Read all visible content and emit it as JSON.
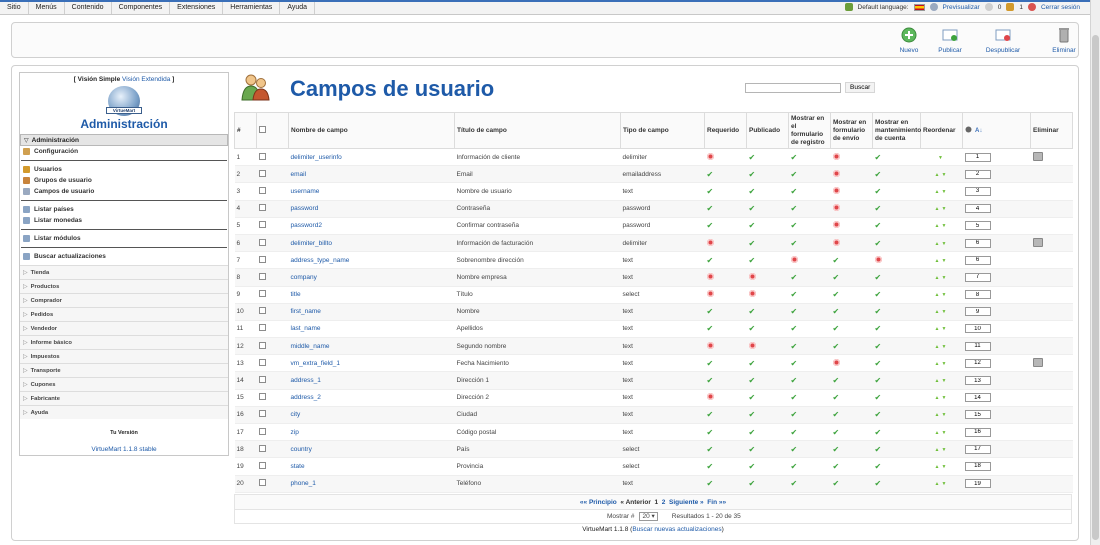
{
  "menubar": {
    "items": [
      "Sitio",
      "Menús",
      "Contenido",
      "Componentes",
      "Extensiones",
      "Herramientas",
      "Ayuda"
    ],
    "default_language_label": "Default language:",
    "preview_label": "Previsualizar",
    "messages_count": "0",
    "users_count": "1",
    "logout_label": "Cerrar sesión"
  },
  "toolbar": {
    "new_label": "Nuevo",
    "publish_label": "Publicar",
    "unpublish_label": "Despublicar",
    "delete_label": "Eliminar"
  },
  "sidebar": {
    "view_simple": "[ Visión Simple",
    "view_extended": "Visión Extendida",
    "view_close": "]",
    "logo_text": "VirtueMart",
    "title": "Administración",
    "section_header": "Administración",
    "config_label": "Configuración",
    "user_items": [
      "Usuarios",
      "Grupos de usuario",
      "Campos de usuario"
    ],
    "list_items": [
      "Listar países",
      "Listar monedas"
    ],
    "modules_label": "Listar módulos",
    "updates_label": "Buscar actualizaciones",
    "collapsed_sections": [
      "Tienda",
      "Productos",
      "Comprador",
      "Pedidos",
      "Vendedor",
      "Informe básico",
      "Impuestos",
      "Transporte",
      "Cupones",
      "Fabricante",
      "Ayuda"
    ],
    "version_heading": "Tu Versión",
    "version_link": "VirtueMart 1.1.8 stable"
  },
  "page": {
    "title": "Campos de usuario",
    "search_button": "Buscar"
  },
  "table": {
    "headers": {
      "num": "#",
      "field_name": "Nombre de campo",
      "field_title": "Título de campo",
      "field_type": "Tipo de campo",
      "required": "Requerido",
      "published": "Publicado",
      "show_register": "Mostrar en el formulario de registro",
      "show_shipping": "Mostrar en formulario de envío",
      "show_account": "Mostrar en mantenimiento de cuenta",
      "reorder": "Reordenar",
      "delete": "Eliminar"
    },
    "rows": [
      {
        "n": "1",
        "name": "delimiter_userinfo",
        "title": "Información de cliente",
        "type": "delimiter",
        "req": false,
        "pub": true,
        "reg": true,
        "ship": false,
        "acct": true,
        "up": false,
        "down": true,
        "order": "1",
        "del": true
      },
      {
        "n": "2",
        "name": "email",
        "title": "Email",
        "type": "emailaddress",
        "req": true,
        "pub": true,
        "reg": true,
        "ship": false,
        "acct": true,
        "up": true,
        "down": true,
        "order": "2",
        "del": false
      },
      {
        "n": "3",
        "name": "username",
        "title": "Nombre de usuario",
        "type": "text",
        "req": true,
        "pub": true,
        "reg": true,
        "ship": false,
        "acct": true,
        "up": true,
        "down": true,
        "order": "3",
        "del": false
      },
      {
        "n": "4",
        "name": "password",
        "title": "Contraseña",
        "type": "password",
        "req": true,
        "pub": true,
        "reg": true,
        "ship": false,
        "acct": true,
        "up": true,
        "down": true,
        "order": "4",
        "del": false
      },
      {
        "n": "5",
        "name": "password2",
        "title": "Confirmar contraseña",
        "type": "password",
        "req": true,
        "pub": true,
        "reg": true,
        "ship": false,
        "acct": true,
        "up": true,
        "down": true,
        "order": "5",
        "del": false
      },
      {
        "n": "6",
        "name": "delimiter_billto",
        "title": "Información de facturación",
        "type": "delimiter",
        "req": false,
        "pub": true,
        "reg": true,
        "ship": false,
        "acct": true,
        "up": true,
        "down": true,
        "order": "6",
        "del": true
      },
      {
        "n": "7",
        "name": "address_type_name",
        "title": "Sobrenombre dirección",
        "type": "text",
        "req": true,
        "pub": true,
        "reg": false,
        "ship": true,
        "acct": false,
        "up": true,
        "down": true,
        "order": "6",
        "del": false
      },
      {
        "n": "8",
        "name": "company",
        "title": "Nombre empresa",
        "type": "text",
        "req": false,
        "pub": false,
        "reg": true,
        "ship": true,
        "acct": true,
        "up": true,
        "down": true,
        "order": "7",
        "del": false
      },
      {
        "n": "9",
        "name": "title",
        "title": "Título",
        "type": "select",
        "req": false,
        "pub": false,
        "reg": true,
        "ship": true,
        "acct": true,
        "up": true,
        "down": true,
        "order": "8",
        "del": false
      },
      {
        "n": "10",
        "name": "first_name",
        "title": "Nombre",
        "type": "text",
        "req": true,
        "pub": true,
        "reg": true,
        "ship": true,
        "acct": true,
        "up": true,
        "down": true,
        "order": "9",
        "del": false
      },
      {
        "n": "11",
        "name": "last_name",
        "title": "Apellidos",
        "type": "text",
        "req": true,
        "pub": true,
        "reg": true,
        "ship": true,
        "acct": true,
        "up": true,
        "down": true,
        "order": "10",
        "del": false
      },
      {
        "n": "12",
        "name": "middle_name",
        "title": "Segundo nombre",
        "type": "text",
        "req": false,
        "pub": false,
        "reg": true,
        "ship": true,
        "acct": true,
        "up": true,
        "down": true,
        "order": "11",
        "del": false
      },
      {
        "n": "13",
        "name": "vm_extra_field_1",
        "title": "Fecha Nacimiento",
        "type": "text",
        "req": true,
        "pub": true,
        "reg": true,
        "ship": false,
        "acct": true,
        "up": true,
        "down": true,
        "order": "12",
        "del": true
      },
      {
        "n": "14",
        "name": "address_1",
        "title": "Dirección 1",
        "type": "text",
        "req": true,
        "pub": true,
        "reg": true,
        "ship": true,
        "acct": true,
        "up": true,
        "down": true,
        "order": "13",
        "del": false
      },
      {
        "n": "15",
        "name": "address_2",
        "title": "Dirección 2",
        "type": "text",
        "req": false,
        "pub": true,
        "reg": true,
        "ship": true,
        "acct": true,
        "up": true,
        "down": true,
        "order": "14",
        "del": false
      },
      {
        "n": "16",
        "name": "city",
        "title": "Ciudad",
        "type": "text",
        "req": true,
        "pub": true,
        "reg": true,
        "ship": true,
        "acct": true,
        "up": true,
        "down": true,
        "order": "15",
        "del": false
      },
      {
        "n": "17",
        "name": "zip",
        "title": "Código postal",
        "type": "text",
        "req": true,
        "pub": true,
        "reg": true,
        "ship": true,
        "acct": true,
        "up": true,
        "down": true,
        "order": "16",
        "del": false
      },
      {
        "n": "18",
        "name": "country",
        "title": "País",
        "type": "select",
        "req": true,
        "pub": true,
        "reg": true,
        "ship": true,
        "acct": true,
        "up": true,
        "down": true,
        "order": "17",
        "del": false
      },
      {
        "n": "19",
        "name": "state",
        "title": "Provincia",
        "type": "select",
        "req": true,
        "pub": true,
        "reg": true,
        "ship": true,
        "acct": true,
        "up": true,
        "down": true,
        "order": "18",
        "del": false
      },
      {
        "n": "20",
        "name": "phone_1",
        "title": "Teléfono",
        "type": "text",
        "req": true,
        "pub": true,
        "reg": true,
        "ship": true,
        "acct": true,
        "up": true,
        "down": true,
        "order": "19",
        "del": false
      }
    ]
  },
  "pagination": {
    "first": "«« Principio",
    "prev": "« Anterior",
    "page1": "1",
    "page2": "2",
    "next": "Siguiente »",
    "last": "Fin »»",
    "show_label": "Mostrar #",
    "per_page": "20",
    "results": "Resultados 1 - 20 de 35"
  },
  "footer": {
    "version": "VirtueMart 1.1.8",
    "updates_link": "Buscar nuevas actualizaciones"
  },
  "colors": {
    "accent": "#1e5aa8",
    "check": "#3da33d",
    "cross": "#e0464a"
  }
}
